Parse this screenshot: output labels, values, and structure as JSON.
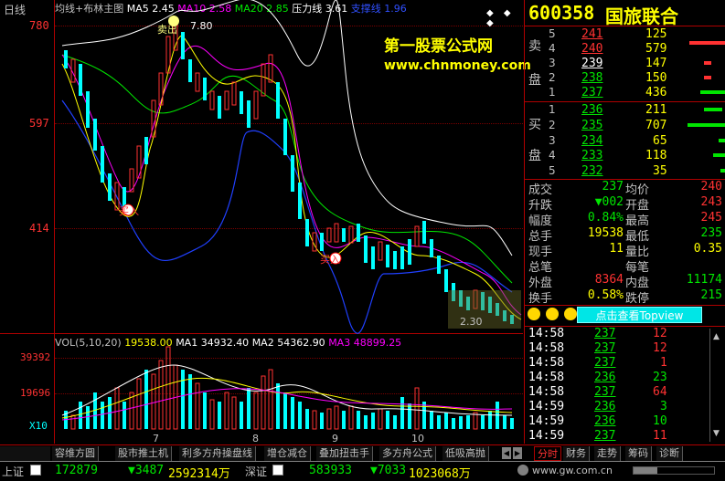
{
  "title_bar": {
    "period": "日线",
    "indicator": "均线+布林主图",
    "ma5": "MA5 2.45",
    "ma10": "MA10 2.58",
    "ma20": "MA20 2.85",
    "pressure": "压力线 3.61",
    "support": "支撑线 1.96"
  },
  "watermark": {
    "line1": "第一股票公式网",
    "line2": "www.chnmoney.com"
  },
  "price_axis": [
    "780",
    "597",
    "414"
  ],
  "chart_annotations": {
    "sell": "卖出",
    "buy1": "买入",
    "buy2": "买入",
    "high": "7.80",
    "low": "2.30"
  },
  "volume_title": {
    "vol": "VOL(5,10,20)",
    "v": "19538.00",
    "ma1": "MA1 34932.40",
    "ma2": "MA2 54362.90",
    "ma3": "MA3 48899.25"
  },
  "volume_axis": [
    "39392",
    "19696",
    "X10"
  ],
  "date_ticks": [
    "7",
    "8",
    "9",
    "10"
  ],
  "stock": {
    "code": "600358",
    "name": "国旅联合"
  },
  "order_book": {
    "sell_label": [
      "卖",
      "盘"
    ],
    "buy_label": [
      "买",
      "盘"
    ],
    "sell": [
      {
        "level": "5",
        "price": "241",
        "vol": "125"
      },
      {
        "level": "4",
        "price": "240",
        "vol": "579"
      },
      {
        "level": "3",
        "price": "239",
        "vol": "147"
      },
      {
        "level": "2",
        "price": "238",
        "vol": "150"
      },
      {
        "level": "1",
        "price": "237",
        "vol": "436"
      }
    ],
    "buy": [
      {
        "level": "1",
        "price": "236",
        "vol": "211"
      },
      {
        "level": "2",
        "price": "235",
        "vol": "707"
      },
      {
        "level": "3",
        "price": "234",
        "vol": "65"
      },
      {
        "level": "4",
        "price": "233",
        "vol": "118"
      },
      {
        "level": "5",
        "price": "232",
        "vol": "35"
      }
    ]
  },
  "stats": [
    {
      "l1": "成交",
      "v1": "237",
      "l2": "均价",
      "v2": "240"
    },
    {
      "l1": "升跌",
      "v1": "▼002",
      "l2": "开盘",
      "v2": "243"
    },
    {
      "l1": "幅度",
      "v1": "0.84%",
      "l2": "最高",
      "v2": "245"
    },
    {
      "l1": "总手",
      "v1": "19538",
      "l2": "最低",
      "v2": "235"
    },
    {
      "l1": "现手",
      "v1": "11",
      "l2": "量比",
      "v2": "0.35"
    },
    {
      "l1": "总笔",
      "v1": "",
      "l2": "每笔",
      "v2": ""
    },
    {
      "l1": "外盘",
      "v1": "8364",
      "l2": "内盘",
      "v2": "11174"
    },
    {
      "l1": "换手",
      "v1": "0.58%",
      "l2": "跌停",
      "v2": "215"
    }
  ],
  "topview_button": "点击查看Topview",
  "ticks": [
    {
      "time": "14:58",
      "price": "237",
      "vol": "12"
    },
    {
      "time": "14:58",
      "price": "237",
      "vol": "12"
    },
    {
      "time": "14:58",
      "price": "237",
      "vol": "1"
    },
    {
      "time": "14:58",
      "price": "236",
      "vol": "23"
    },
    {
      "time": "14:58",
      "price": "237",
      "vol": "64"
    },
    {
      "time": "14:59",
      "price": "236",
      "vol": "3"
    },
    {
      "time": "14:59",
      "price": "236",
      "vol": "10"
    },
    {
      "time": "14:59",
      "price": "237",
      "vol": "11"
    }
  ],
  "bottom_tabs": [
    "容维方圆",
    "股市推土机",
    "利多方舟操盘线",
    "增仓减仓",
    "叠加扭击手",
    "多方舟公式",
    "低吸高抛"
  ],
  "right_tabs": [
    "分时",
    "财务",
    "走势",
    "筹码",
    "诊断"
  ],
  "status": {
    "sh_label": "上证",
    "sh_index": "172879",
    "sh_change": "▼3487",
    "sh_amount": "2592314万",
    "sz_label": "深证",
    "sz_index": "583933",
    "sz_change": "▼7033",
    "sz_amount": "1023068万",
    "url": "www.gw.com.cn"
  }
}
